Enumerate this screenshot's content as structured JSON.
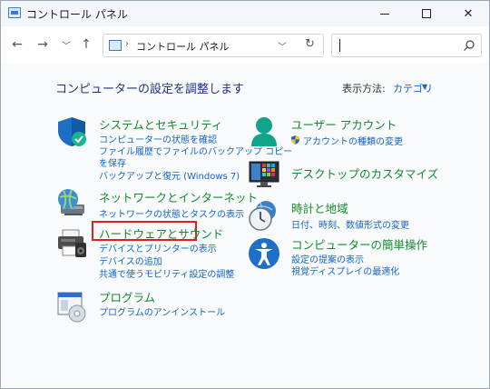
{
  "window": {
    "title": "コントロール パネル"
  },
  "address": {
    "path": "コントロール パネル",
    "separator": "›"
  },
  "content": {
    "heading": "コンピューターの設定を調整します",
    "view_by_label": "表示方法:",
    "view_by_value": "カテゴリ"
  },
  "categories": [
    {
      "title": "システムとセキュリティ",
      "links": [
        "コンピューターの状態を確認",
        "ファイル履歴でファイルのバックアップ コピー",
        "を保存",
        "バックアップと復元 (Windows 7)"
      ],
      "icon": "shield-icon"
    },
    {
      "title": "ネットワークとインターネット",
      "links": [
        "ネットワークの状態とタスクの表示"
      ],
      "icon": "network-icon"
    },
    {
      "title": "ハードウェアとサウンド",
      "links": [
        "デバイスとプリンターの表示",
        "デバイスの追加",
        "共通で使うモビリティ設定の調整"
      ],
      "icon": "printer-icon"
    },
    {
      "title": "プログラム",
      "links": [
        "プログラムのアンインストール"
      ],
      "icon": "programs-icon"
    },
    {
      "title": "ユーザー アカウント",
      "links": [
        "アカウントの種類の変更"
      ],
      "icon": "user-icon"
    },
    {
      "title": "デスクトップのカスタマイズ",
      "links": [],
      "icon": "desktop-icon"
    },
    {
      "title": "時計と地域",
      "links": [
        "日付、時刻、数値形式の変更"
      ],
      "icon": "clock-icon"
    },
    {
      "title": "コンピューターの簡単操作",
      "links": [
        "設定の提案の表示",
        "視覚ディスプレイの最適化"
      ],
      "icon": "accessibility-icon"
    }
  ],
  "colors": {
    "heading": "#1e3287",
    "category_title": "#138a2d",
    "link": "#1565c0",
    "highlight": "#e0201e"
  }
}
